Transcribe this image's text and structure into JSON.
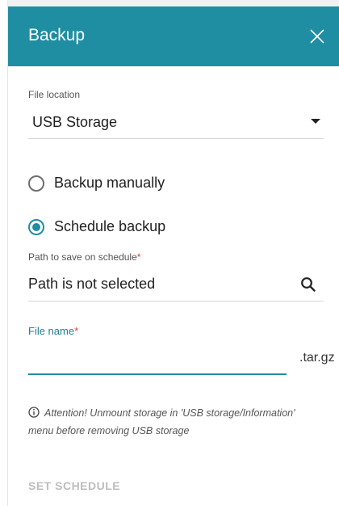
{
  "dialog": {
    "title": "Backup",
    "close_icon": "close-icon"
  },
  "file_location": {
    "label": "File location",
    "value": "USB Storage"
  },
  "mode": {
    "options": [
      {
        "label": "Backup manually",
        "checked": false
      },
      {
        "label": "Schedule backup",
        "checked": true
      }
    ]
  },
  "path": {
    "label": "Path to save on schedule",
    "required_mark": "*",
    "value": "Path is not selected",
    "icon": "search-icon"
  },
  "file_name": {
    "label": "File name",
    "required_mark": "*",
    "value": "",
    "suffix": ".tar.gz"
  },
  "info": {
    "icon": "info-icon",
    "text": "Attention! Unmount storage in 'USB storage/Information' menu before removing USB storage"
  },
  "actions": {
    "set_schedule": "SET SCHEDULE"
  },
  "colors": {
    "accent": "#1f8ea3",
    "required": "#e23b3b",
    "disabled": "#bdbdbd"
  }
}
